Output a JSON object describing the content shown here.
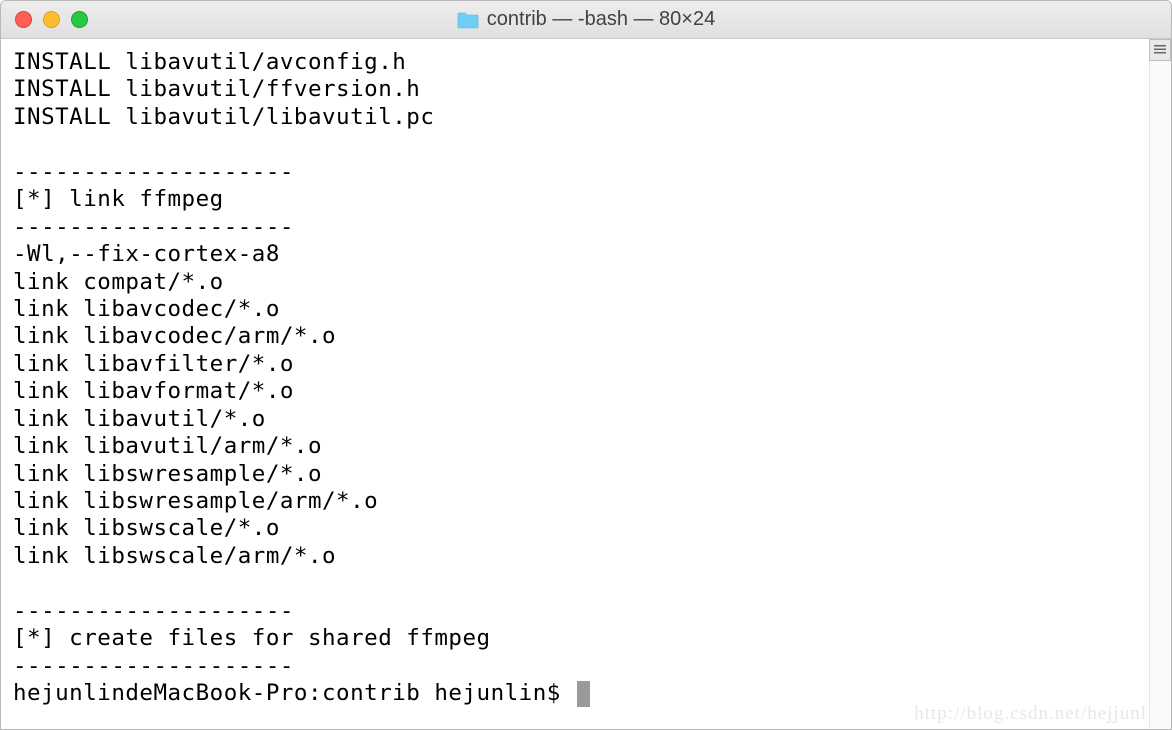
{
  "titlebar": {
    "title": "contrib — -bash — 80×24"
  },
  "terminal": {
    "lines": [
      "INSTALL libavutil/avconfig.h",
      "INSTALL libavutil/ffversion.h",
      "INSTALL libavutil/libavutil.pc",
      "",
      "--------------------",
      "[*] link ffmpeg",
      "--------------------",
      "-Wl,--fix-cortex-a8",
      "link compat/*.o",
      "link libavcodec/*.o",
      "link libavcodec/arm/*.o",
      "link libavfilter/*.o",
      "link libavformat/*.o",
      "link libavutil/*.o",
      "link libavutil/arm/*.o",
      "link libswresample/*.o",
      "link libswresample/arm/*.o",
      "link libswscale/*.o",
      "link libswscale/arm/*.o",
      "",
      "--------------------",
      "[*] create files for shared ffmpeg",
      "--------------------"
    ],
    "prompt": "hejunlindeMacBook-Pro:contrib hejunlin$ "
  },
  "watermark": "http://blog.csdn.net/hejjunl"
}
